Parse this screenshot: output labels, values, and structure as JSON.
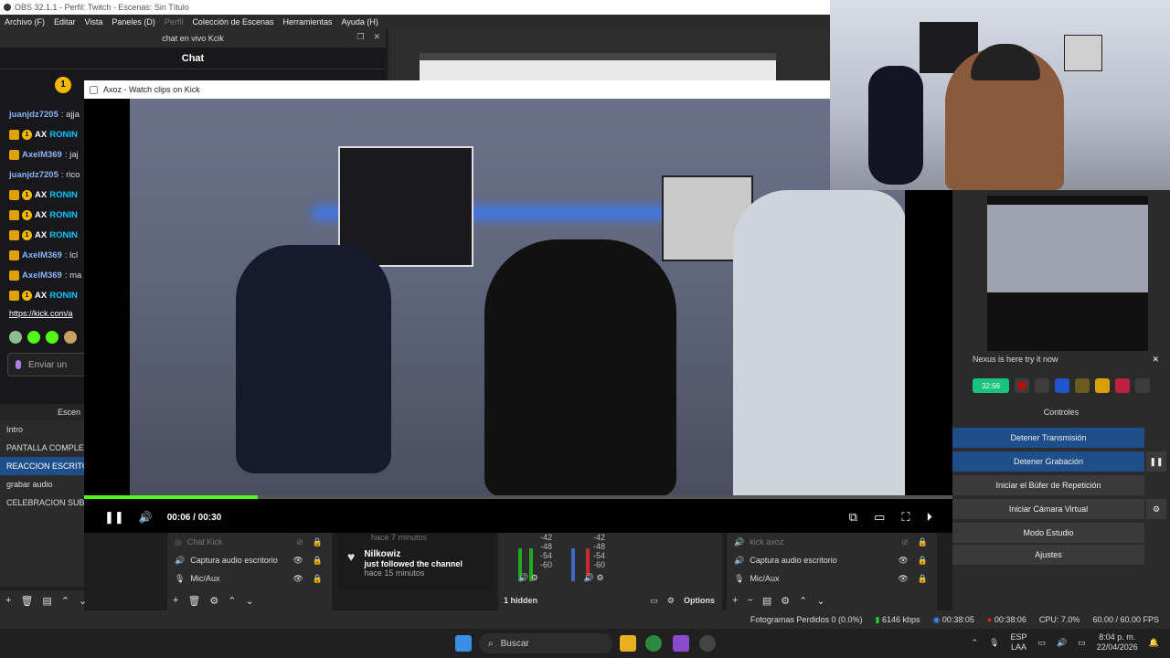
{
  "window": {
    "title": "OBS 32.1.1 - Perfil: Twitch - Escenas: Sin Título"
  },
  "menu": [
    "Archivo (F)",
    "Editar",
    "Vista",
    "Paneles (D)",
    "Perfil",
    "Colección de Escenas",
    "Herramientas",
    "Ayuda (H)"
  ],
  "chat": {
    "dock_title": "chat en vivo Kcik",
    "header": "Chat",
    "messages": [
      {
        "user": "juanjdz7205",
        "text": ": ajja",
        "color": "#8ab4f8"
      },
      {
        "user": "RONIN",
        "text": "",
        "color": "#00c8ff"
      },
      {
        "user": "AxelM369",
        "text": ": jaj",
        "color": "#8ab4f8"
      },
      {
        "user": "juanjdz7205",
        "text": ": rico",
        "color": "#8ab4f8"
      },
      {
        "user": "RONIN",
        "text": "",
        "color": "#00c8ff"
      },
      {
        "user": "RONIN",
        "text": "",
        "color": "#00c8ff"
      },
      {
        "user": "RONIN",
        "text": "",
        "color": "#00c8ff"
      },
      {
        "user": "AxelM369",
        "text": ": lcl",
        "color": "#8ab4f8"
      },
      {
        "user": "AxelM369",
        "text": ": ma",
        "color": "#8ab4f8"
      },
      {
        "user": "RONIN",
        "text": "",
        "color": "#00c8ff"
      }
    ],
    "link": "https://kick.com/a",
    "input_placeholder": "Enviar un",
    "badge_number": "1",
    "ax_label": "AX"
  },
  "scenes": {
    "header": "Escen",
    "items": [
      "Intro",
      "PANTALLA COMPLETA",
      "REACCION ESCRITOR",
      "grabar audio",
      "CELEBRACION SUB"
    ],
    "selected_index": 2
  },
  "player": {
    "title": "Axoz - Watch clips on Kick",
    "current_time": "00:06",
    "duration": "00:30",
    "progress": 0.2
  },
  "sources_left": [
    {
      "name": "Chat Kick",
      "dim": true
    },
    {
      "name": "Captura audio escritorio",
      "dim": false
    },
    {
      "name": "Mic/Aux",
      "dim": false
    }
  ],
  "alert": {
    "prev_time": "hace 7 minutos",
    "name": "Nilkowiz",
    "message": "just followed the channel",
    "time": "hace 15 minutos"
  },
  "mixer": {
    "hidden_label": "1 hidden",
    "options_label": "Options",
    "scale": [
      "-42",
      "-48",
      "-54",
      "-60"
    ]
  },
  "sources_right": [
    {
      "name": "kick axoz",
      "dim": true
    },
    {
      "name": "Captura audio escritorio",
      "dim": false
    },
    {
      "name": "Mic/Aux",
      "dim": false
    }
  ],
  "controls": {
    "header": "Controles",
    "nexus": "Nexus is here try it now",
    "live_time": "32:56",
    "buttons": [
      "Detener Transmisión",
      "Detener Grabación",
      "Iniciar el Búfer de Repetición",
      "Iniciar Cámara Virtual",
      "Modo Estudio",
      "Ajustes"
    ]
  },
  "status": {
    "dropped": "Fotogramas Perdidos 0 (0.0%)",
    "bitrate": "6146 kbps",
    "stream_time": "00:38:05",
    "rec_time": "00:38:06",
    "cpu": "CPU: 7.0%",
    "fps": "60.00 / 60.00 FPS"
  },
  "taskbar": {
    "search_placeholder": "Buscar",
    "lang": "ESP",
    "layout": "LAA",
    "time": "8:04 p. m.",
    "date": "22/04/2026"
  },
  "colors": {
    "accent": "#53fc18",
    "selection": "#1f4f8a",
    "live": "#19c37d"
  }
}
